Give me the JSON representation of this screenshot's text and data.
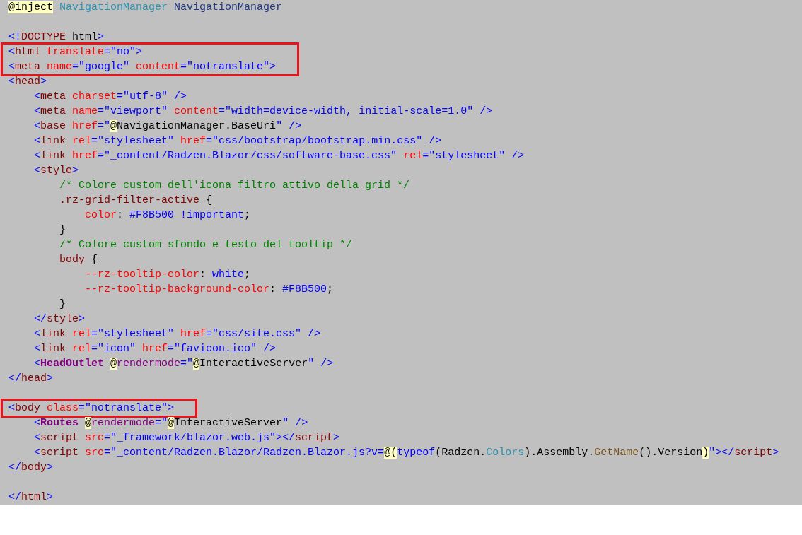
{
  "groups": [
    {
      "boxed": false,
      "lines": [
        {
          "kind": "code",
          "tokens": [
            {
              "kind": "razor",
              "text": "@inject"
            },
            {
              "kind": "type",
              "text": " NavigationManager"
            },
            {
              "kind": "ident",
              "text": " NavigationManager"
            }
          ]
        },
        {
          "kind": "blank"
        },
        {
          "kind": "code",
          "tokens": [
            {
              "kind": "bracket",
              "text": "<!"
            },
            {
              "kind": "tag",
              "text": "DOCTYPE"
            },
            {
              "kind": "plain",
              "text": " html"
            },
            {
              "kind": "bracket",
              "text": ">"
            }
          ]
        }
      ]
    },
    {
      "boxed": true,
      "lines": [
        {
          "kind": "code",
          "tokens": [
            {
              "kind": "bracket",
              "text": "<"
            },
            {
              "kind": "tag",
              "text": "html"
            },
            {
              "kind": "attr",
              "text": " translate"
            },
            {
              "kind": "bracket",
              "text": "=\"no\">"
            }
          ]
        },
        {
          "kind": "code",
          "tokens": [
            {
              "kind": "bracket",
              "text": "<"
            },
            {
              "kind": "tag",
              "text": "meta"
            },
            {
              "kind": "attr",
              "text": " name"
            },
            {
              "kind": "bracket",
              "text": "=\"google\""
            },
            {
              "kind": "attr",
              "text": " content"
            },
            {
              "kind": "bracket",
              "text": "=\"notranslate\">"
            }
          ]
        }
      ]
    },
    {
      "boxed": false,
      "lines": [
        {
          "kind": "code",
          "tokens": [
            {
              "kind": "bracket",
              "text": "<"
            },
            {
              "kind": "tag",
              "text": "head"
            },
            {
              "kind": "bracket",
              "text": ">"
            }
          ]
        },
        {
          "kind": "code",
          "tokens": [
            {
              "kind": "bracket",
              "text": "    <"
            },
            {
              "kind": "tag",
              "text": "meta"
            },
            {
              "kind": "attr",
              "text": " charset"
            },
            {
              "kind": "bracket",
              "text": "=\"utf-8\" />"
            }
          ]
        },
        {
          "kind": "code",
          "tokens": [
            {
              "kind": "bracket",
              "text": "    <"
            },
            {
              "kind": "tag",
              "text": "meta"
            },
            {
              "kind": "attr",
              "text": " name"
            },
            {
              "kind": "bracket",
              "text": "=\"viewport\""
            },
            {
              "kind": "attr",
              "text": " content"
            },
            {
              "kind": "bracket",
              "text": "=\"width=device-width, initial-scale=1.0\" />"
            }
          ]
        },
        {
          "kind": "code",
          "tokens": [
            {
              "kind": "bracket",
              "text": "    <"
            },
            {
              "kind": "tag",
              "text": "base"
            },
            {
              "kind": "attr",
              "text": " href"
            },
            {
              "kind": "bracket",
              "text": "=\""
            },
            {
              "kind": "razor",
              "text": "@"
            },
            {
              "kind": "plain",
              "text": "NavigationManager.BaseUri"
            },
            {
              "kind": "bracket",
              "text": "\" />"
            }
          ]
        },
        {
          "kind": "code",
          "tokens": [
            {
              "kind": "bracket",
              "text": "    <"
            },
            {
              "kind": "tag",
              "text": "link"
            },
            {
              "kind": "attr",
              "text": " rel"
            },
            {
              "kind": "bracket",
              "text": "=\"stylesheet\""
            },
            {
              "kind": "attr",
              "text": " href"
            },
            {
              "kind": "bracket",
              "text": "=\"css/bootstrap/bootstrap.min.css\" />"
            }
          ]
        },
        {
          "kind": "code",
          "tokens": [
            {
              "kind": "bracket",
              "text": "    <"
            },
            {
              "kind": "tag",
              "text": "link"
            },
            {
              "kind": "attr",
              "text": " href"
            },
            {
              "kind": "bracket",
              "text": "=\"_content/Radzen.Blazor/css/software-base.css\""
            },
            {
              "kind": "attr",
              "text": " rel"
            },
            {
              "kind": "bracket",
              "text": "=\"stylesheet\" />"
            }
          ]
        },
        {
          "kind": "code",
          "tokens": [
            {
              "kind": "bracket",
              "text": "    <"
            },
            {
              "kind": "tag",
              "text": "style"
            },
            {
              "kind": "bracket",
              "text": ">"
            }
          ]
        },
        {
          "kind": "code",
          "tokens": [
            {
              "kind": "comment",
              "text": "        /* Colore custom dell'icona filtro attivo della grid */"
            }
          ]
        },
        {
          "kind": "code",
          "tokens": [
            {
              "kind": "tag",
              "text": "        .rz-grid-filter-active"
            },
            {
              "kind": "plain",
              "text": " {"
            }
          ]
        },
        {
          "kind": "code",
          "tokens": [
            {
              "kind": "attr",
              "text": "            color"
            },
            {
              "kind": "plain",
              "text": ":"
            },
            {
              "kind": "bracket",
              "text": " #F8B500 !important"
            },
            {
              "kind": "plain",
              "text": ";"
            }
          ]
        },
        {
          "kind": "code",
          "tokens": [
            {
              "kind": "plain",
              "text": "        }"
            }
          ]
        },
        {
          "kind": "code",
          "tokens": [
            {
              "kind": "comment",
              "text": "        /* Colore custom sfondo e testo del tooltip */"
            }
          ]
        },
        {
          "kind": "code",
          "tokens": [
            {
              "kind": "tag",
              "text": "        body"
            },
            {
              "kind": "plain",
              "text": " {"
            }
          ]
        },
        {
          "kind": "code",
          "tokens": [
            {
              "kind": "attr",
              "text": "            --rz-tooltip-color"
            },
            {
              "kind": "plain",
              "text": ":"
            },
            {
              "kind": "bracket",
              "text": " white"
            },
            {
              "kind": "plain",
              "text": ";"
            }
          ]
        },
        {
          "kind": "code",
          "tokens": [
            {
              "kind": "attr",
              "text": "            --rz-tooltip-background-color"
            },
            {
              "kind": "plain",
              "text": ":"
            },
            {
              "kind": "bracket",
              "text": " #F8B500"
            },
            {
              "kind": "plain",
              "text": ";"
            }
          ]
        },
        {
          "kind": "code",
          "tokens": [
            {
              "kind": "plain",
              "text": "        }"
            }
          ]
        },
        {
          "kind": "code",
          "tokens": [
            {
              "kind": "bracket",
              "text": "    </"
            },
            {
              "kind": "tag",
              "text": "style"
            },
            {
              "kind": "bracket",
              "text": ">"
            }
          ]
        },
        {
          "kind": "code",
          "tokens": [
            {
              "kind": "bracket",
              "text": "    <"
            },
            {
              "kind": "tag",
              "text": "link"
            },
            {
              "kind": "attr",
              "text": " rel"
            },
            {
              "kind": "bracket",
              "text": "=\"stylesheet\""
            },
            {
              "kind": "attr",
              "text": " href"
            },
            {
              "kind": "bracket",
              "text": "=\"css/site.css\" />"
            }
          ]
        },
        {
          "kind": "code",
          "tokens": [
            {
              "kind": "bracket",
              "text": "    <"
            },
            {
              "kind": "tag",
              "text": "link"
            },
            {
              "kind": "attr",
              "text": " rel"
            },
            {
              "kind": "bracket",
              "text": "=\"icon\""
            },
            {
              "kind": "attr",
              "text": " href"
            },
            {
              "kind": "bracket",
              "text": "=\"favicon.ico\" />"
            }
          ]
        },
        {
          "kind": "code",
          "tokens": [
            {
              "kind": "bracket",
              "text": "    <"
            },
            {
              "kind": "component",
              "text": "HeadOutlet "
            },
            {
              "kind": "razor",
              "text": "@"
            },
            {
              "kind": "directive",
              "text": "rendermode"
            },
            {
              "kind": "bracket",
              "text": "=\""
            },
            {
              "kind": "razor",
              "text": "@"
            },
            {
              "kind": "plain",
              "text": "InteractiveServer"
            },
            {
              "kind": "bracket",
              "text": "\" />"
            }
          ]
        },
        {
          "kind": "code",
          "tokens": [
            {
              "kind": "bracket",
              "text": "</"
            },
            {
              "kind": "tag",
              "text": "head"
            },
            {
              "kind": "bracket",
              "text": ">"
            }
          ]
        },
        {
          "kind": "blank"
        }
      ]
    },
    {
      "boxed": true,
      "lines": [
        {
          "kind": "code",
          "tokens": [
            {
              "kind": "bracket",
              "text": "<"
            },
            {
              "kind": "tag",
              "text": "body"
            },
            {
              "kind": "attr",
              "text": " class"
            },
            {
              "kind": "bracket",
              "text": "=\"notranslate\">"
            }
          ]
        }
      ]
    },
    {
      "boxed": false,
      "lines": [
        {
          "kind": "code",
          "tokens": [
            {
              "kind": "bracket",
              "text": "    <"
            },
            {
              "kind": "component",
              "text": "Routes "
            },
            {
              "kind": "razor",
              "text": "@"
            },
            {
              "kind": "directive",
              "text": "rendermode"
            },
            {
              "kind": "bracket",
              "text": "=\""
            },
            {
              "kind": "razor",
              "text": "@"
            },
            {
              "kind": "plain",
              "text": "InteractiveServer"
            },
            {
              "kind": "bracket",
              "text": "\" />"
            }
          ]
        },
        {
          "kind": "code",
          "tokens": [
            {
              "kind": "bracket",
              "text": "    <"
            },
            {
              "kind": "tag",
              "text": "script"
            },
            {
              "kind": "attr",
              "text": " src"
            },
            {
              "kind": "bracket",
              "text": "=\"_framework/blazor.web.js\"></"
            },
            {
              "kind": "tag",
              "text": "script"
            },
            {
              "kind": "bracket",
              "text": ">"
            }
          ]
        },
        {
          "kind": "code",
          "tokens": [
            {
              "kind": "bracket",
              "text": "    <"
            },
            {
              "kind": "tag",
              "text": "script"
            },
            {
              "kind": "attr",
              "text": " src"
            },
            {
              "kind": "bracket",
              "text": "=\"_content/Radzen.Blazor/Radzen.Blazor.js?v="
            },
            {
              "kind": "razor",
              "text": "@("
            },
            {
              "kind": "keyword",
              "text": "typeof"
            },
            {
              "kind": "plain",
              "text": "(Radzen."
            },
            {
              "kind": "type",
              "text": "Colors"
            },
            {
              "kind": "plain",
              "text": ").Assembly."
            },
            {
              "kind": "method",
              "text": "GetName"
            },
            {
              "kind": "plain",
              "text": "().Version"
            },
            {
              "kind": "razor",
              "text": ")"
            },
            {
              "kind": "bracket",
              "text": "\"></"
            },
            {
              "kind": "tag",
              "text": "script"
            },
            {
              "kind": "bracket",
              "text": ">"
            }
          ]
        },
        {
          "kind": "code",
          "tokens": [
            {
              "kind": "bracket",
              "text": "</"
            },
            {
              "kind": "tag",
              "text": "body"
            },
            {
              "kind": "bracket",
              "text": ">"
            }
          ]
        },
        {
          "kind": "blank"
        },
        {
          "kind": "code",
          "tokens": [
            {
              "kind": "bracket",
              "text": "</"
            },
            {
              "kind": "tag",
              "text": "html"
            },
            {
              "kind": "bracket",
              "text": ">"
            }
          ]
        }
      ]
    }
  ]
}
